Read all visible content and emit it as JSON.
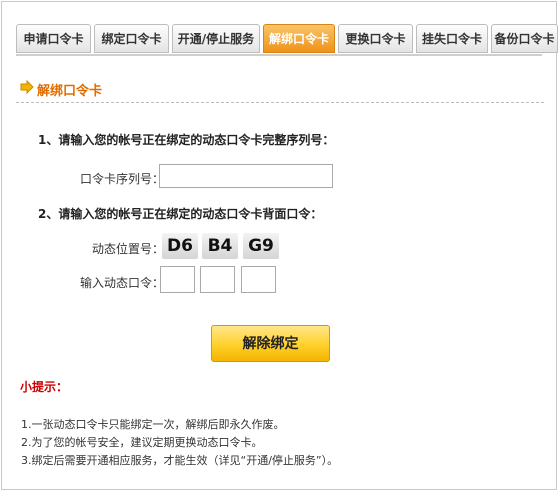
{
  "tabs": [
    {
      "label": "申请口令卡",
      "active": false
    },
    {
      "label": "绑定口令卡",
      "active": false
    },
    {
      "label": "开通/停止服务",
      "active": false
    },
    {
      "label": "解绑口令卡",
      "active": true
    },
    {
      "label": "更换口令卡",
      "active": false
    },
    {
      "label": "挂失口令卡",
      "active": false
    },
    {
      "label": "备份口令卡",
      "active": false
    }
  ],
  "section": {
    "title": "解绑口令卡",
    "icon": "arrow-right-icon"
  },
  "step1": {
    "text": "1、请输入您的帐号正在绑定的动态口令卡完整序列号：",
    "serial_label": "口令卡序列号：",
    "serial_value": ""
  },
  "step2": {
    "text": "2、请输入您的帐号正在绑定的动态口令卡背面口令：",
    "position_label": "动态位置号：",
    "codes": [
      "D6",
      "B4",
      "G9"
    ],
    "input_label": "输入动态口令："
  },
  "submit_label": "解除绑定",
  "tips": {
    "title": "小提示：",
    "items": [
      "1.一张动态口令卡只能绑定一次，解绑后即永久作废。",
      "2.为了您的帐号安全，建议定期更换动态口令卡。",
      "3.绑定后需要开通相应服务，才能生效（详见“开通/停止服务”）。"
    ]
  },
  "colors": {
    "accent": "#ee9318",
    "title": "#e06d00",
    "tip_title": "#cc0000",
    "button": "#ffd02a"
  }
}
